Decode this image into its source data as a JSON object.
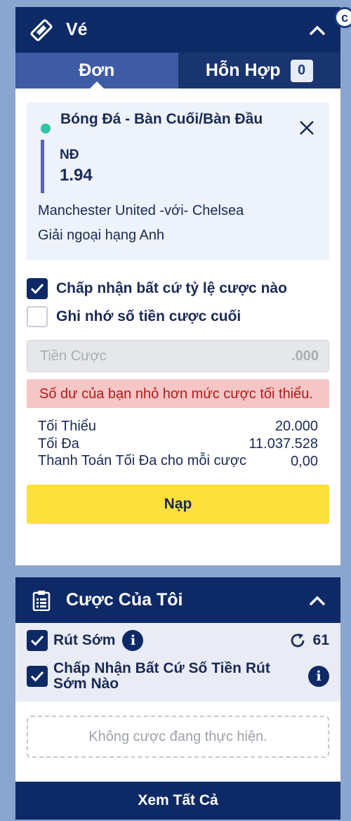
{
  "ticket": {
    "title": "Vé",
    "tabs": [
      {
        "label": "Đơn"
      },
      {
        "label": "Hỗn Hợp",
        "count": "0"
      }
    ],
    "bet": {
      "market": "Bóng Đá - Bàn Cuối/Bàn Đầu",
      "selection": "NĐ",
      "odds": "1.94",
      "match": "Manchester United -với- Chelsea",
      "league": "Giải ngoại hạng Anh"
    },
    "options": {
      "accept_any_odds": "Chấp nhận bất cứ tỷ lệ cược nào",
      "remember_stake": "Ghi nhớ số tiền cược cuối"
    },
    "stake": {
      "placeholder": "Tiền Cược",
      "suffix": ".000"
    },
    "error": "Số dư của bạn nhỏ hơn mức cược tối thiểu.",
    "limits": {
      "min_label": "Tối Thiểu",
      "min_value": "20.000",
      "max_label": "Tối Đa",
      "max_value": "11.037.528",
      "max_payout_label": "Thanh Toán Tối Đa cho mỗi cược",
      "max_payout_value": "0,00"
    },
    "deposit_label": "Nạp"
  },
  "my_bets": {
    "title": "Cược Của Tôi",
    "cash_out_label": "Rút Sớm",
    "refresh_count": "61",
    "accept_cash_out_label": "Chấp Nhận Bất Cứ Số Tiền Rút Sớm Nào",
    "empty_text": "Không cược đang thực hiện.",
    "see_all_label": "Xem Tất Cả"
  },
  "colors": {
    "header": "#0e2a66",
    "tab_active": "#3f5ba6",
    "accent_yellow": "#fde03b",
    "error_bg": "#f5c6c6",
    "status_dot": "#2ec4a5"
  },
  "icons": [
    "ticket-icon",
    "chevron-up-icon",
    "close-icon",
    "checkmark-icon",
    "clipboard-icon",
    "info-icon",
    "refresh-icon"
  ]
}
